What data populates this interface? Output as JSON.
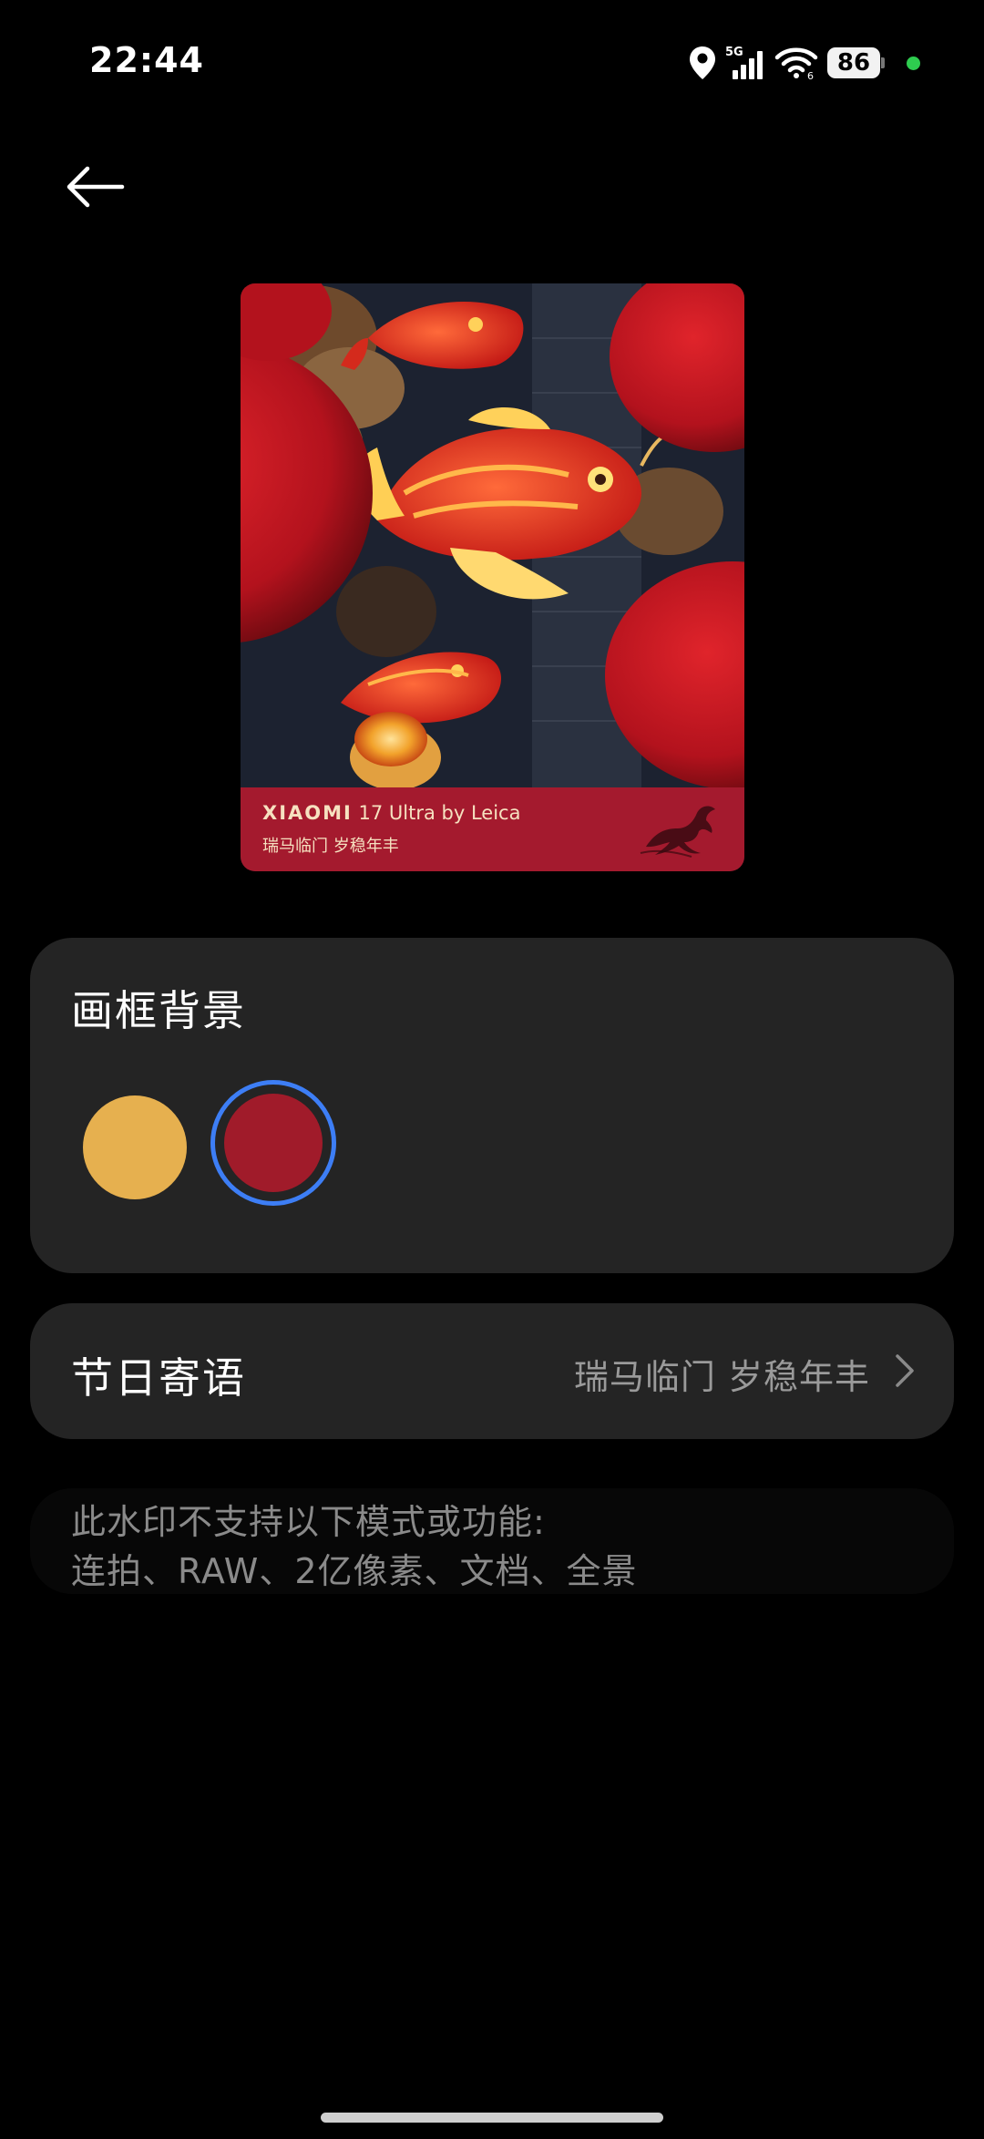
{
  "status_bar": {
    "time": "22:44",
    "network": "5G",
    "battery": "86",
    "icons": [
      "location-icon",
      "signal-icon",
      "wifi-icon",
      "battery-icon"
    ]
  },
  "nav": {
    "back_icon": "back-arrow-icon"
  },
  "preview": {
    "brand_logo": "XIAOMI",
    "brand_model": "17 Ultra by Leica",
    "blessing": "瑞马临门 岁稳年丰",
    "band_color": "#a41a2e"
  },
  "frame_background": {
    "title": "画框背景",
    "options": [
      {
        "name": "yellow",
        "color": "#e6b04f",
        "selected": false
      },
      {
        "name": "red",
        "color": "#a01b2a",
        "selected": true
      }
    ],
    "selection_ring_color": "#3d7ef5"
  },
  "holiday_greeting": {
    "title": "节日寄语",
    "value": "瑞马临门 岁稳年丰"
  },
  "note": {
    "line1": "此水印不支持以下模式或功能:",
    "line2": "连拍、RAW、2亿像素、文档、全景"
  }
}
